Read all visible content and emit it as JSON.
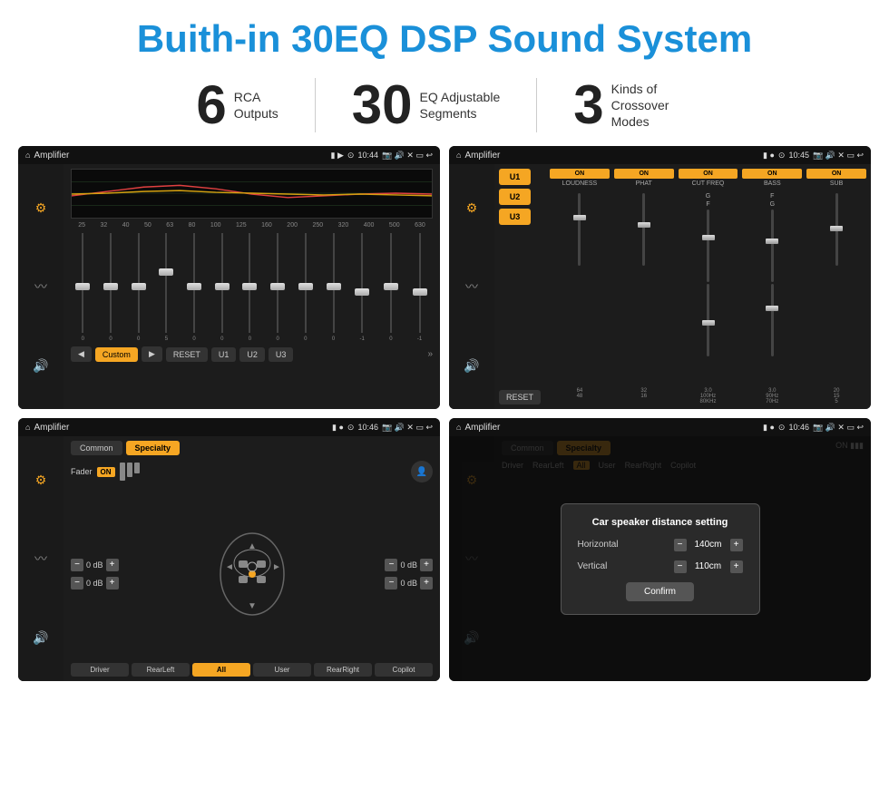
{
  "page": {
    "title": "Buith-in 30EQ DSP Sound System",
    "stats": [
      {
        "number": "6",
        "text": "RCA\nOutputs"
      },
      {
        "number": "30",
        "text": "EQ Adjustable\nSegments"
      },
      {
        "number": "3",
        "text": "Kinds of\nCrossover Modes"
      }
    ],
    "screens": [
      {
        "id": "eq-screen",
        "statusBar": {
          "home": "⌂",
          "title": "Amplifier",
          "icons": "▮ ▶",
          "location": "⊙",
          "time": "10:44",
          "extra": "📷 🔊 ✕ ▭ ↩"
        }
      },
      {
        "id": "amp2-screen",
        "statusBar": {
          "home": "⌂",
          "title": "Amplifier",
          "icons": "▮ ●",
          "time": "10:45"
        }
      },
      {
        "id": "cross-screen",
        "statusBar": {
          "home": "⌂",
          "title": "Amplifier",
          "icons": "▮ ●",
          "time": "10:46"
        }
      },
      {
        "id": "dialog-screen",
        "statusBar": {
          "home": "⌂",
          "title": "Amplifier",
          "icons": "▮ ●",
          "time": "10:46"
        },
        "dialog": {
          "title": "Car speaker distance setting",
          "rows": [
            {
              "label": "Horizontal",
              "value": "140cm"
            },
            {
              "label": "Vertical",
              "value": "110cm"
            }
          ],
          "confirm": "Confirm"
        }
      }
    ],
    "eqFreqs": [
      "25",
      "32",
      "40",
      "50",
      "63",
      "80",
      "100",
      "125",
      "160",
      "200",
      "250",
      "320",
      "400",
      "500",
      "630"
    ],
    "eqVals": [
      "0",
      "0",
      "0",
      "5",
      "0",
      "0",
      "0",
      "0",
      "0",
      "0",
      "-1",
      "0",
      "-1"
    ],
    "eqBottomBtns": [
      "◀",
      "Custom",
      "▶",
      "RESET",
      "U1",
      "U2",
      "U3"
    ],
    "presets": [
      "U1",
      "U2",
      "U3"
    ],
    "channelLabels": [
      "LOUDNESS",
      "PHAT",
      "CUT FREQ",
      "BASS",
      "SUB"
    ],
    "crossTabs": [
      "Common",
      "Specialty"
    ],
    "crossBtns": [
      "Driver",
      "RearLeft",
      "All",
      "User",
      "RearRight",
      "Copilot"
    ],
    "dialogConfirm": "Confirm"
  }
}
